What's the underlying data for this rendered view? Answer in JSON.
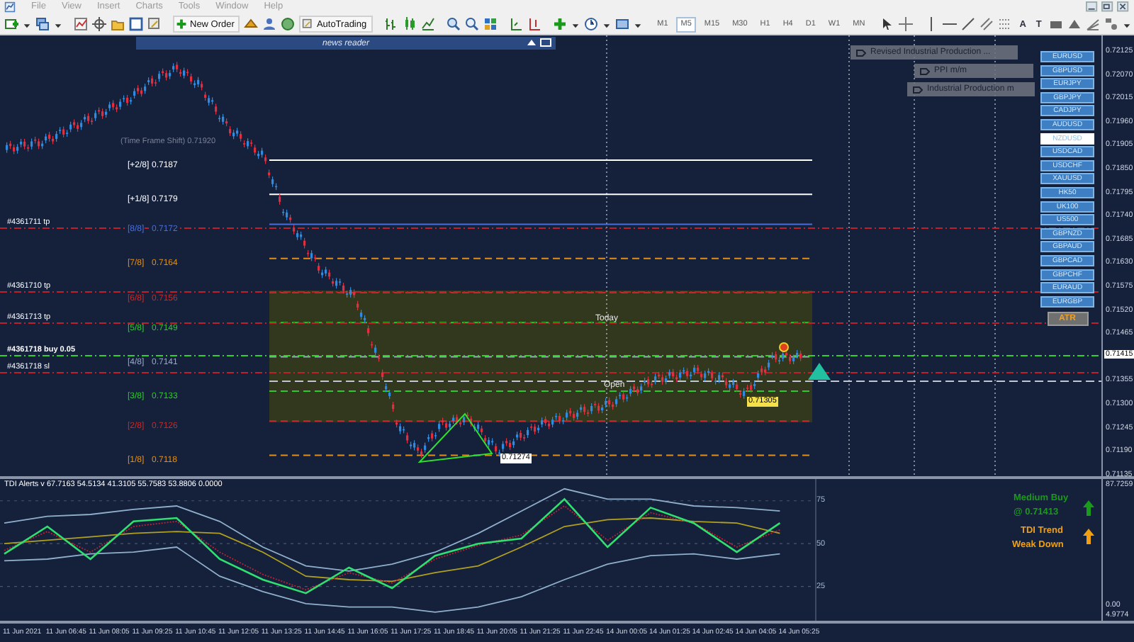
{
  "menu": [
    "File",
    "View",
    "Insert",
    "Charts",
    "Tools",
    "Window",
    "Help"
  ],
  "toolbar": {
    "new_order": "New Order",
    "autotrading": "AutoTrading",
    "text_tool": "A",
    "label_tool": "T",
    "timeframes": [
      {
        "label": "M1",
        "selected": false
      },
      {
        "label": "M5",
        "selected": true
      },
      {
        "label": "M15",
        "selected": false
      },
      {
        "label": "M30",
        "selected": false
      },
      {
        "label": "H1",
        "selected": false
      },
      {
        "label": "H4",
        "selected": false
      },
      {
        "label": "D1",
        "selected": false
      },
      {
        "label": "W1",
        "selected": false
      },
      {
        "label": "MN",
        "selected": false
      }
    ]
  },
  "news_reader": {
    "title": "news reader"
  },
  "news": [
    "Revised Industrial Production ...",
    "PPI m/m",
    "Industrial Production m"
  ],
  "symbols": [
    {
      "label": "EURUSD",
      "selected": false
    },
    {
      "label": "GBPUSD",
      "selected": false
    },
    {
      "label": "EURJPY",
      "selected": false
    },
    {
      "label": "GBPJPY",
      "selected": false
    },
    {
      "label": "CADJPY",
      "selected": false
    },
    {
      "label": "AUDUSD",
      "selected": false
    },
    {
      "label": "NZDUSD",
      "selected": true
    },
    {
      "label": "USDCAD",
      "selected": false
    },
    {
      "label": "USDCHF",
      "selected": false
    },
    {
      "label": "XAUUSD",
      "selected": false
    },
    {
      "label": "HK50",
      "selected": false
    },
    {
      "label": "UK100",
      "selected": false
    },
    {
      "label": "US500",
      "selected": false
    },
    {
      "label": "GBPNZD",
      "selected": false
    },
    {
      "label": "GBPAUD",
      "selected": false
    },
    {
      "label": "GBPCAD",
      "selected": false
    },
    {
      "label": "GBPCHF",
      "selected": false
    },
    {
      "label": "EURAUD",
      "selected": false
    },
    {
      "label": "EURGBP",
      "selected": false
    }
  ],
  "atr_button": "ATR",
  "price_axis": {
    "ticks": [
      "0.72125",
      "0.72070",
      "0.72015",
      "0.71960",
      "0.71905",
      "0.71850",
      "0.71795",
      "0.71740",
      "0.71685",
      "0.71630",
      "0.71575",
      "0.71520",
      "0.71465",
      "0.71355",
      "0.71300",
      "0.71245",
      "0.71190",
      "0.71135"
    ],
    "current": "0.71415"
  },
  "frame_shift_label": "(Time Frame Shift) 0.71920",
  "murrey_levels": [
    {
      "label": "[+2/8]",
      "price": "0.7187",
      "color": "#ffffff"
    },
    {
      "label": "[+1/8]",
      "price": "0.7179",
      "color": "#ffffff"
    },
    {
      "label": "[8/8]",
      "price": "0.7172",
      "color": "#4a6fd8"
    },
    {
      "label": "[7/8]",
      "price": "0.7164",
      "color": "#e0901a"
    },
    {
      "label": "[6/8]",
      "price": "0.7156",
      "color": "#c82a2a"
    },
    {
      "label": "[5/8]",
      "price": "0.7149",
      "color": "#2ec82e"
    },
    {
      "label": "[4/8]",
      "price": "0.7141",
      "color": "#9aa8c8"
    },
    {
      "label": "[3/8]",
      "price": "0.7133",
      "color": "#2ec82e"
    },
    {
      "label": "[2/8]",
      "price": "0.7126",
      "color": "#c82a2a"
    },
    {
      "label": "[1/8]",
      "price": "0.7118",
      "color": "#e0901a"
    }
  ],
  "orders": [
    {
      "label": "#4361711 tp",
      "kind": "tp"
    },
    {
      "label": "#4361710 tp",
      "kind": "tp"
    },
    {
      "label": "#4361713 tp",
      "kind": "tp"
    },
    {
      "label": "#4361718 buy 0.05",
      "kind": "buy"
    },
    {
      "label": "#4361718 sl",
      "kind": "sl"
    }
  ],
  "zone_label": "Today",
  "open_label": "Open",
  "price_tags": [
    {
      "text": "0.71305",
      "color": "#f3e04a"
    },
    {
      "text": "0.71274",
      "color": "#ffffff"
    }
  ],
  "indicator": {
    "title": "TDI Alerts v 67.7163 54.5134 41.3105 55.7583 53.8806 0.0000",
    "axis": [
      "87.7259",
      "0.00",
      "4.9774"
    ],
    "signal": [
      "Medium Buy",
      "@ 0.71413"
    ],
    "trend": [
      "TDI Trend",
      "Weak Down"
    ],
    "time_axis": [
      "11 Jun 2021",
      "11 Jun 06:45",
      "11 Jun 08:05",
      "11 Jun 09:25",
      "11 Jun 10:45",
      "11 Jun 12:05",
      "11 Jun 13:25",
      "11 Jun 14:45",
      "11 Jun 16:05",
      "11 Jun 17:25",
      "11 Jun 18:45",
      "11 Jun 20:05",
      "11 Jun 21:25",
      "11 Jun 22:45",
      "14 Jun 00:05",
      "14 Jun 01:25",
      "14 Jun 02:45",
      "14 Jun 04:05",
      "14 Jun 05:25"
    ],
    "chart_data": {
      "type": "line",
      "grid": true,
      "ylim": [
        4.9774,
        87.7259
      ],
      "yticks": [
        {
          "value": 75,
          "label": "75"
        },
        {
          "value": 50,
          "label": "50"
        },
        {
          "value": 25,
          "label": "25"
        }
      ],
      "series": [
        {
          "color": "#8fb0cc",
          "values": [
            62,
            66,
            67,
            70,
            72,
            63,
            48,
            37,
            34,
            38,
            45,
            56,
            69,
            82,
            76,
            76,
            72,
            71,
            69
          ]
        },
        {
          "color": "#8fb0cc",
          "values": [
            40,
            41,
            44,
            45,
            48,
            31,
            22,
            15,
            13,
            13,
            10,
            13,
            19,
            29,
            38,
            43,
            44,
            41,
            44
          ]
        },
        {
          "color": "#b0a020",
          "values": [
            50,
            52,
            54,
            56,
            57,
            56,
            45,
            31,
            29,
            28,
            33,
            37,
            48,
            60,
            64,
            65,
            63,
            62,
            56
          ]
        },
        {
          "color": "#c02030",
          "line_style": "dotted",
          "values": [
            46,
            57,
            45,
            60,
            63,
            45,
            32,
            23,
            33,
            27,
            41,
            49,
            55,
            72,
            52,
            68,
            62,
            48,
            58
          ]
        },
        {
          "color": "#30e070",
          "values": [
            44,
            60,
            41,
            63,
            65,
            41,
            29,
            21,
            36,
            24,
            43,
            50,
            53,
            76,
            48,
            71,
            62,
            45,
            62
          ]
        }
      ]
    }
  }
}
